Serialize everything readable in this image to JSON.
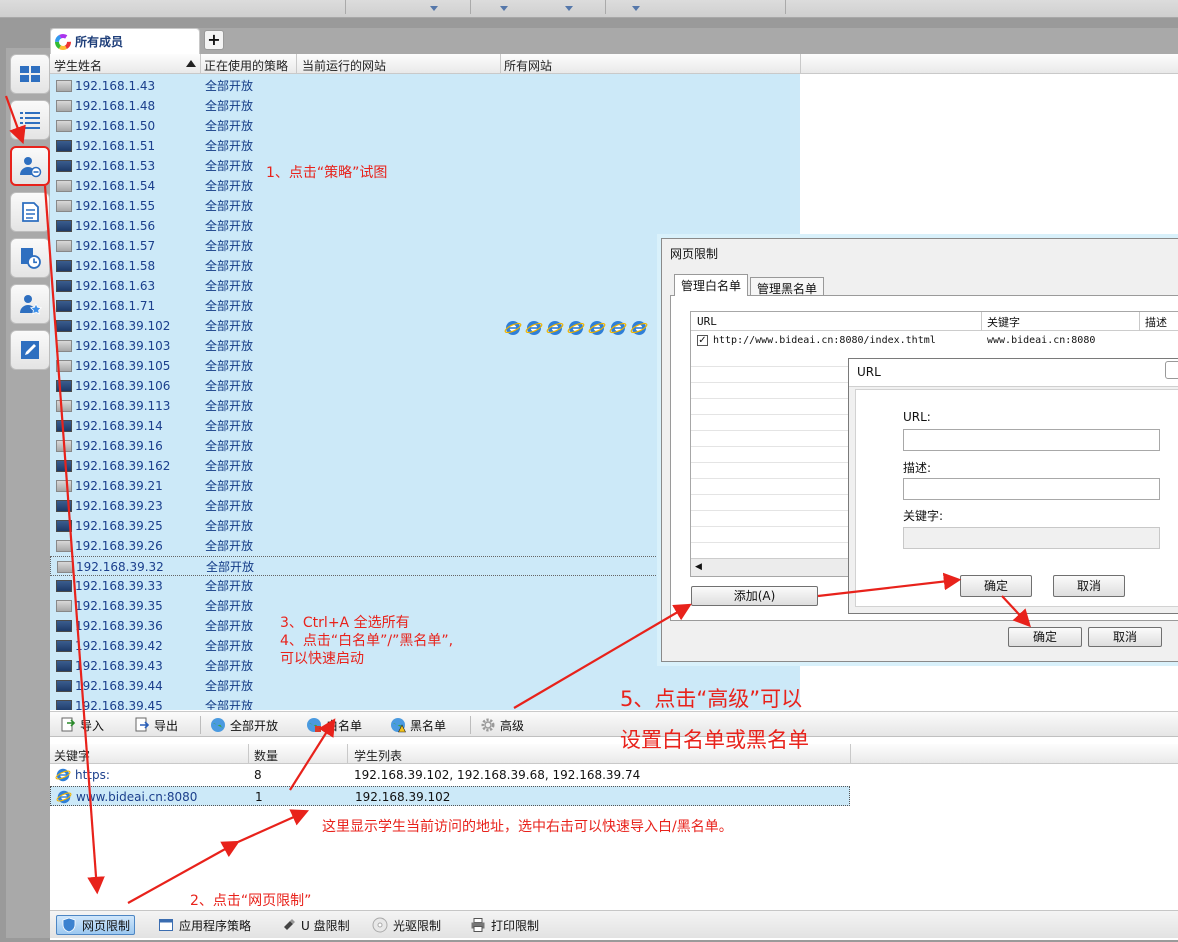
{
  "tab": {
    "label": "所有成员",
    "add_label": "+"
  },
  "columns": {
    "name": "学生姓名",
    "policy": "正在使用的策略",
    "site": "当前运行的网站",
    "all_sites": "所有网站"
  },
  "rows": [
    {
      "ip": "192.168.1.43",
      "policy": "全部开放",
      "online": false
    },
    {
      "ip": "192.168.1.48",
      "policy": "全部开放",
      "online": false
    },
    {
      "ip": "192.168.1.50",
      "policy": "全部开放",
      "online": false
    },
    {
      "ip": "192.168.1.51",
      "policy": "全部开放",
      "online": true
    },
    {
      "ip": "192.168.1.53",
      "policy": "全部开放",
      "online": true
    },
    {
      "ip": "192.168.1.54",
      "policy": "全部开放",
      "online": false
    },
    {
      "ip": "192.168.1.55",
      "policy": "全部开放",
      "online": false
    },
    {
      "ip": "192.168.1.56",
      "policy": "全部开放",
      "online": true
    },
    {
      "ip": "192.168.1.57",
      "policy": "全部开放",
      "online": false
    },
    {
      "ip": "192.168.1.58",
      "policy": "全部开放",
      "online": true
    },
    {
      "ip": "192.168.1.63",
      "policy": "全部开放",
      "online": true
    },
    {
      "ip": "192.168.1.71",
      "policy": "全部开放",
      "online": true
    },
    {
      "ip": "192.168.39.102",
      "policy": "全部开放",
      "online": true
    },
    {
      "ip": "192.168.39.103",
      "policy": "全部开放",
      "online": false
    },
    {
      "ip": "192.168.39.105",
      "policy": "全部开放",
      "online": false
    },
    {
      "ip": "192.168.39.106",
      "policy": "全部开放",
      "online": true
    },
    {
      "ip": "192.168.39.113",
      "policy": "全部开放",
      "online": false
    },
    {
      "ip": "192.168.39.14",
      "policy": "全部开放",
      "online": true
    },
    {
      "ip": "192.168.39.16",
      "policy": "全部开放",
      "online": false
    },
    {
      "ip": "192.168.39.162",
      "policy": "全部开放",
      "online": true
    },
    {
      "ip": "192.168.39.21",
      "policy": "全部开放",
      "online": false
    },
    {
      "ip": "192.168.39.23",
      "policy": "全部开放",
      "online": true
    },
    {
      "ip": "192.168.39.25",
      "policy": "全部开放",
      "online": true
    },
    {
      "ip": "192.168.39.26",
      "policy": "全部开放",
      "online": false
    },
    {
      "ip": "192.168.39.32",
      "policy": "全部开放",
      "online": false,
      "selected": true
    },
    {
      "ip": "192.168.39.33",
      "policy": "全部开放",
      "online": true
    },
    {
      "ip": "192.168.39.35",
      "policy": "全部开放",
      "online": false
    },
    {
      "ip": "192.168.39.36",
      "policy": "全部开放",
      "online": true
    },
    {
      "ip": "192.168.39.42",
      "policy": "全部开放",
      "online": true
    },
    {
      "ip": "192.168.39.43",
      "policy": "全部开放",
      "online": true
    },
    {
      "ip": "192.168.39.44",
      "policy": "全部开放",
      "online": true
    },
    {
      "ip": "192.168.39.45",
      "policy": "全部开放",
      "online": true
    }
  ],
  "site_icon_count": 7,
  "toolbar": {
    "import": "导入",
    "export": "导出",
    "all_open": "全部开放",
    "whitelist": "白名单",
    "blacklist": "黑名单",
    "advanced": "高级"
  },
  "keyword_table": {
    "headers": {
      "keyword": "关键字",
      "count": "数量",
      "students": "学生列表"
    },
    "rows": [
      {
        "keyword": "https:",
        "count": "8",
        "students": "192.168.39.102, 192.168.39.68, 192.168.39.74"
      },
      {
        "keyword": "www.bideai.cn:8080",
        "count": "1",
        "students": "192.168.39.102",
        "selected": true
      }
    ]
  },
  "bottom_tabs": [
    {
      "label": "网页限制",
      "active": true,
      "icon": "shield-icon"
    },
    {
      "label": "应用程序策略",
      "active": false,
      "icon": "window-icon"
    },
    {
      "label": "U 盘限制",
      "active": false,
      "icon": "usb-icon"
    },
    {
      "label": "光驱限制",
      "active": false,
      "icon": "disc-icon"
    },
    {
      "label": "打印限制",
      "active": false,
      "icon": "printer-icon"
    }
  ],
  "dialog_web": {
    "title": "网页限制",
    "tab_white": "管理白名单",
    "tab_black": "管理黑名单",
    "grid": {
      "url": "URL",
      "keyword": "关键字",
      "desc": "描述"
    },
    "entry": {
      "url": "http://www.bideai.cn:8080/index.thtml",
      "keyword": "www.bideai.cn:8080",
      "checked": true
    },
    "add_button": "添加(A)",
    "ok": "确定",
    "cancel": "取消"
  },
  "dialog_url": {
    "title": "URL",
    "url_label": "URL:",
    "desc_label": "描述:",
    "keyword_label": "关键字:",
    "url_value": "",
    "desc_value": "",
    "keyword_value": "",
    "ok": "确定",
    "cancel": "取消"
  },
  "annotations": {
    "step1": "1、点击“策略”试图",
    "step2": "2、点击“网页限制”",
    "step3": "3、Ctrl+A 全选所有",
    "step4a": "4、点击“白名单”/”黑名单”,",
    "step4b": "可以快速启动",
    "step5a": "5、点击“高级”可以",
    "step5b": "设置白名单或黑名单",
    "note": "这里显示学生当前访问的地址，选中右击可以快速导入白/黑名单。"
  },
  "colors": {
    "accent": "#e8221b",
    "list_bg": "#cce9f8",
    "link": "#1b3f8c"
  }
}
